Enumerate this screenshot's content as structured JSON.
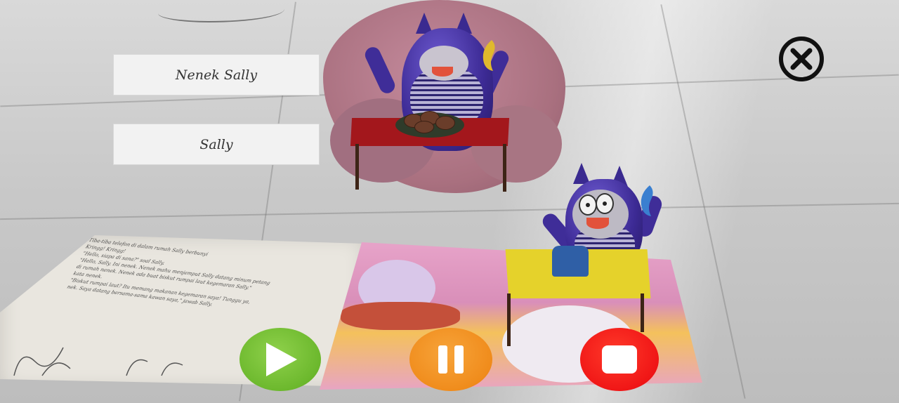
{
  "choices": [
    {
      "label": "Nenek Sally"
    },
    {
      "label": "Sally"
    }
  ],
  "book_text": [
    "Tiba-tiba telefon di dalam rumah Sally berbunyi",
    "Kringg! Kringg!",
    "\"Hello, siapa di sana?\" soal Sally.",
    "\"Hello, Sally. Ini nenek. Nenek mahu menjemput Sally datang minum petang",
    "di rumah nenek. Nenek ada buat biskut rumpai laut kegemaran Sally.\"",
    "kata nenek.",
    "\"Biskut rumpai laut? Itu memang makanan kegemaran saya! Tunggu ya,",
    "nek. Saya datang bersama-sama kawan saya,\" jawab Sally."
  ],
  "controls": {
    "close_icon": "close-x-circle-icon",
    "play_icon": "play-icon",
    "pause_icon": "pause-icon",
    "stop_icon": "stop-icon"
  },
  "colors": {
    "play": "#6cb82d",
    "pause": "#f08c1c",
    "stop": "#f01616",
    "choice_bg": "#f2f2f2"
  }
}
